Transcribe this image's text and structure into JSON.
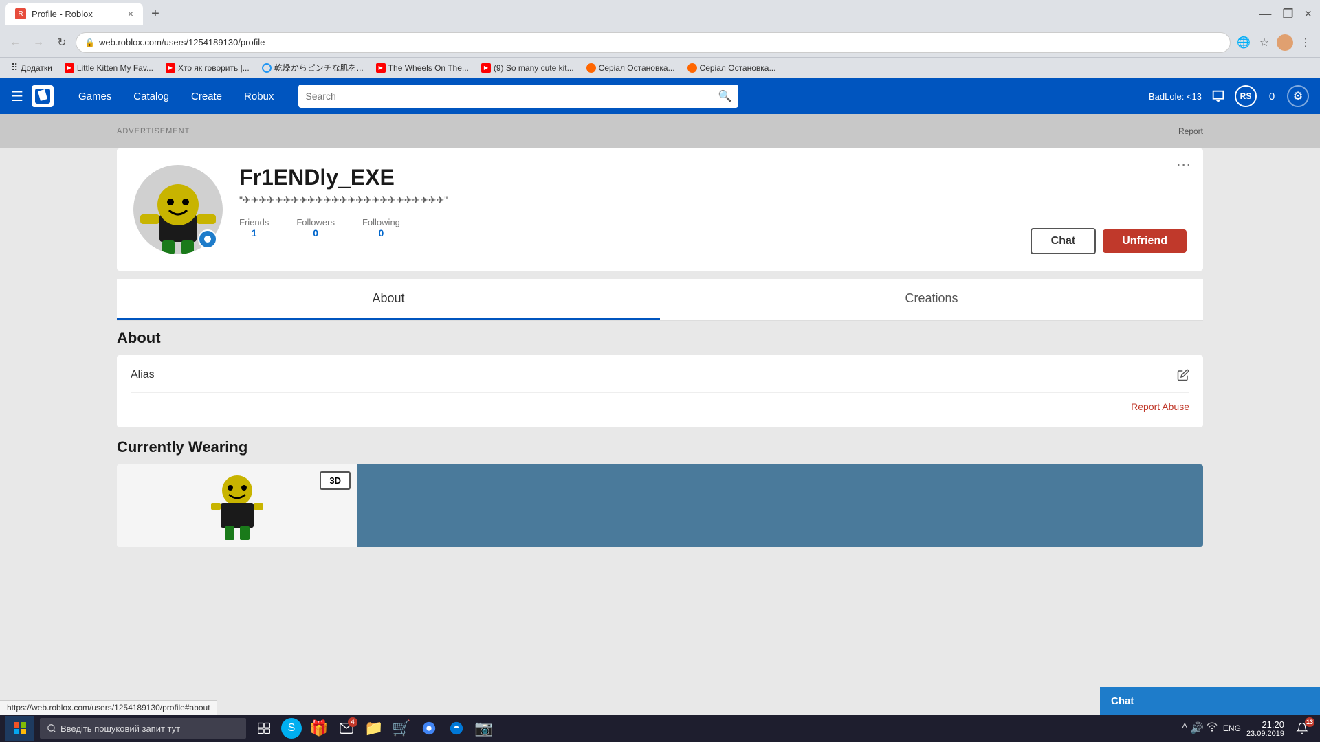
{
  "browser": {
    "tab": {
      "icon": "R",
      "title": "Profile - Roblox",
      "close": "×",
      "new_tab": "+"
    },
    "window_controls": {
      "minimize": "—",
      "maximize": "❐",
      "close": "×"
    },
    "nav": {
      "back_disabled": true,
      "forward_disabled": true,
      "refresh": "↻",
      "url": "web.roblox.com/users/1254189130/profile",
      "lock_icon": "🔒"
    },
    "bookmarks": [
      {
        "icon": "grid",
        "label": "Додатки"
      },
      {
        "icon": "yt",
        "label": "Little Kitten My Fav..."
      },
      {
        "icon": "yt",
        "label": "Хто як говорить |..."
      },
      {
        "icon": "globe",
        "label": "乾燥からピンチな肌を..."
      },
      {
        "icon": "yt",
        "label": "The Wheels On The..."
      },
      {
        "icon": "yt",
        "label": "(9) So many cute kit..."
      },
      {
        "icon": "fox",
        "label": "Серіал Остановка..."
      },
      {
        "icon": "fox",
        "label": "Серіал Остановка..."
      }
    ]
  },
  "roblox_nav": {
    "logo": "R",
    "links": [
      "Games",
      "Catalog",
      "Create",
      "Robux"
    ],
    "search_placeholder": "Search",
    "username": "BadLole: <13",
    "icons": {
      "list": "≡",
      "robux": "RS",
      "zero": "0",
      "gear": "⚙"
    }
  },
  "ad_bar": {
    "label": "ADVERTISEMENT",
    "report": "Report"
  },
  "profile": {
    "username": "Fr1ENDly_EXE",
    "status": "\"✈✈✈✈✈✈✈✈✈✈✈✈✈✈✈✈✈✈✈✈✈✈✈✈✈\"",
    "stats": {
      "friends_label": "Friends",
      "friends_value": "1",
      "followers_label": "Followers",
      "followers_value": "0",
      "following_label": "Following",
      "following_value": "0"
    },
    "actions": {
      "chat": "Chat",
      "unfriend": "Unfriend"
    },
    "more_btn": "···"
  },
  "tabs": [
    {
      "label": "About",
      "active": true
    },
    {
      "label": "Creations",
      "active": false
    }
  ],
  "about": {
    "section_title": "About",
    "alias_label": "Alias",
    "report_abuse": "Report Abuse"
  },
  "currently_wearing": {
    "title": "Currently Wearing",
    "btn_3d": "3D"
  },
  "chat_popup": {
    "label": "Chat"
  },
  "url_status": "https://web.roblox.com/users/1254189130/profile#about",
  "taskbar": {
    "start_label": "",
    "search_placeholder": "Введіть пошуковий запит тут",
    "clock": "21:20",
    "date": "23.09.2019",
    "lang": "ENG",
    "notification_count": "13"
  }
}
